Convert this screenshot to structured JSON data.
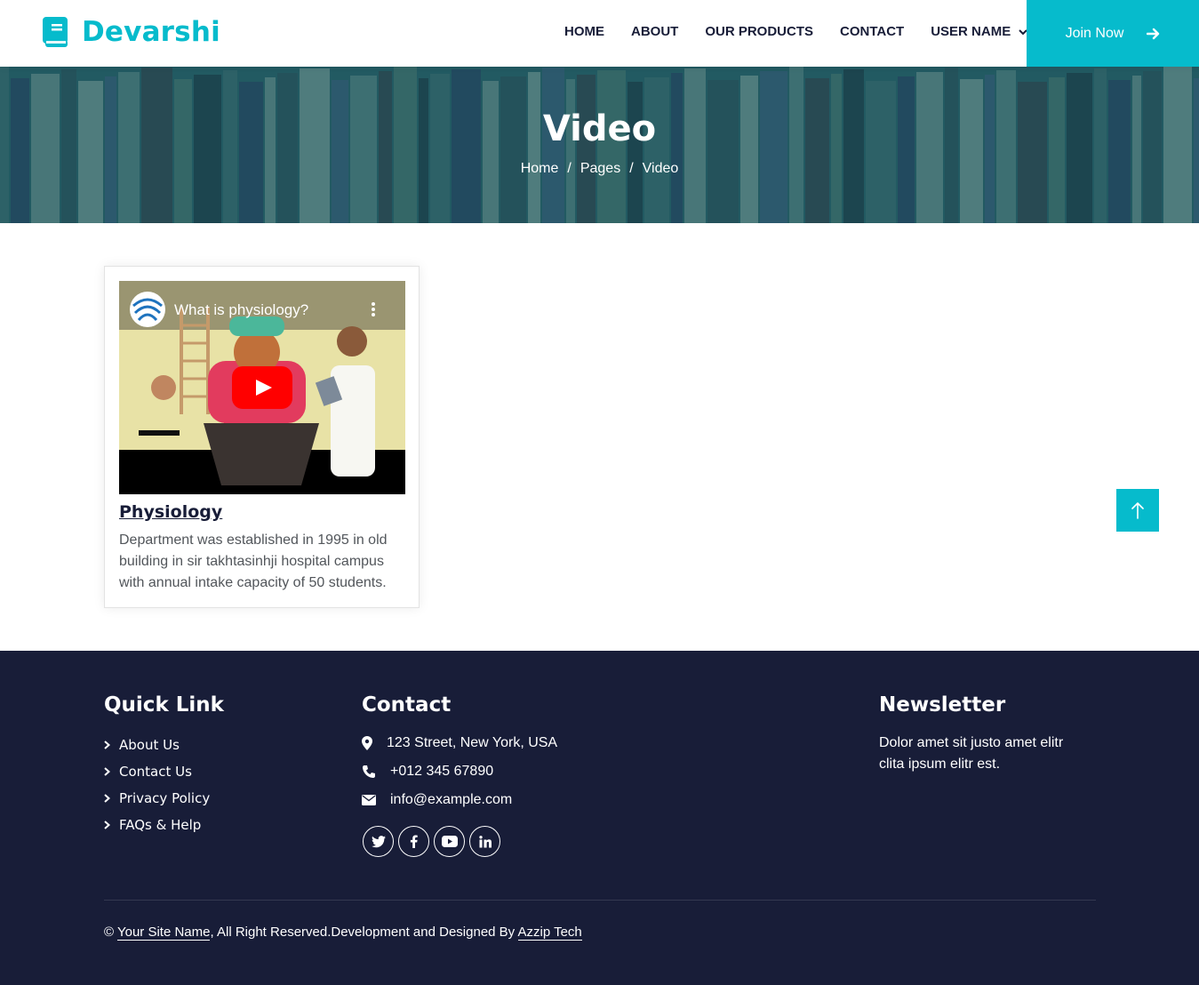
{
  "brand": {
    "name": "Devarshi",
    "icon": "book-icon"
  },
  "nav": {
    "links": [
      "HOME",
      "ABOUT",
      "OUR PRODUCTS",
      "CONTACT",
      "USER NAME"
    ],
    "join_label": "Join Now"
  },
  "hero": {
    "title": "Video",
    "breadcrumb": [
      "Home",
      "Pages",
      "Video"
    ],
    "separator": "/"
  },
  "card": {
    "video_title": "What is physiology?",
    "title": "Physiology",
    "description": "Department was established in 1995 in old building in sir takhtasinhji hospital campus with annual intake capacity of 50 students."
  },
  "footer": {
    "quick_link": {
      "heading": "Quick Link",
      "items": [
        "About Us",
        "Contact Us",
        "Privacy Policy",
        "FAQs & Help"
      ]
    },
    "contact": {
      "heading": "Contact",
      "address": "123 Street, New York, USA",
      "phone": "+012 345 67890",
      "email": "info@example.com",
      "socials": [
        "twitter-icon",
        "facebook-icon",
        "youtube-icon",
        "linkedin-icon"
      ]
    },
    "newsletter": {
      "heading": "Newsletter",
      "text": "Dolor amet sit justo amet elitr clita ipsum elitr est."
    },
    "copyright": {
      "symbol": "©",
      "site_name": "Your Site Name",
      "middle": ", All Right Reserved.Development and Designed By",
      "designer": "Azzip Tech"
    }
  },
  "colors": {
    "accent": "#06bbcc",
    "dark": "#181d38"
  }
}
